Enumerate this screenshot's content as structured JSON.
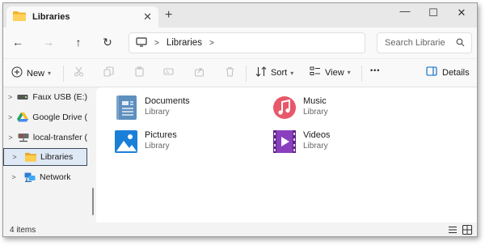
{
  "tab": {
    "title": "Libraries",
    "folder_icon": "folder-icon",
    "close_glyph": "✕"
  },
  "new_tab_glyph": "+",
  "window_controls": {
    "minimize": "—",
    "maximize": "☐",
    "close": "✕"
  },
  "nav": {
    "back": "←",
    "forward": "→",
    "up": "↑",
    "refresh": "↻"
  },
  "address": {
    "crumb": "Libraries"
  },
  "search": {
    "placeholder": "Search Librarie"
  },
  "toolbar": {
    "new_label": "New",
    "sort_label": "Sort",
    "view_label": "View",
    "more_label": "•••",
    "details_label": "Details"
  },
  "sidebar": {
    "items": [
      {
        "label": "Faux USB (E:)",
        "icon": "usb-drive-icon"
      },
      {
        "label": "Google Drive (",
        "icon": "google-drive-icon"
      },
      {
        "label": "local-transfer (",
        "icon": "network-drive-icon"
      },
      {
        "label": "Libraries",
        "icon": "libraries-folder-icon",
        "selected": true
      },
      {
        "label": "Network",
        "icon": "network-icon"
      }
    ]
  },
  "libraries": [
    {
      "name": "Documents",
      "type": "Library",
      "icon": "documents-icon"
    },
    {
      "name": "Music",
      "type": "Library",
      "icon": "music-icon"
    },
    {
      "name": "Pictures",
      "type": "Library",
      "icon": "pictures-icon"
    },
    {
      "name": "Videos",
      "type": "Library",
      "icon": "videos-icon"
    }
  ],
  "status": {
    "item_count": "4 items"
  },
  "colors": {
    "accent": "#0067c0",
    "selection_bg": "#dfe8f5",
    "music": "#e8586a",
    "video": "#8a3fbf",
    "pictures": "#1a7fd8",
    "documents": "#5d8fbf"
  }
}
